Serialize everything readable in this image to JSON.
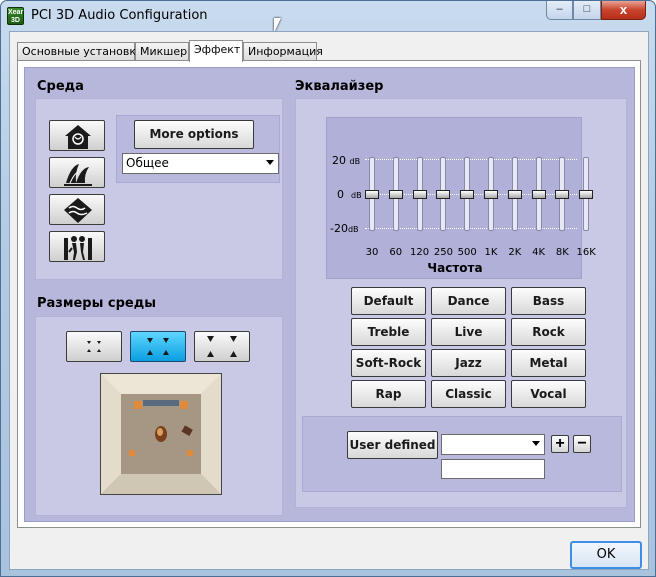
{
  "window": {
    "title": "PCI 3D Audio Configuration",
    "icon_text": "Xear 3D",
    "controls": {
      "minimize": "–",
      "maximize": "□",
      "close": "x"
    }
  },
  "tabs": [
    {
      "label": "Основные установки",
      "active": false
    },
    {
      "label": "Микшер",
      "active": false
    },
    {
      "label": "Эффект",
      "active": true
    },
    {
      "label": "Информация",
      "active": false
    }
  ],
  "environment": {
    "title": "Среда",
    "more_options": "More options",
    "selected": "Общее",
    "icons": [
      "room-icon",
      "opera-house-icon",
      "underwater-icon",
      "walking-icon"
    ]
  },
  "room_size": {
    "title": "Размеры среды",
    "selected_index": 1
  },
  "equalizer": {
    "title": "Эквалайзер",
    "db_top": "20",
    "db_mid": "0",
    "db_bottom": "-20",
    "db_unit": "dB",
    "bands": [
      "30",
      "60",
      "120",
      "250",
      "500",
      "1K",
      "2K",
      "4K",
      "8K",
      "16K"
    ],
    "levels_db": [
      0,
      0,
      0,
      0,
      0,
      0,
      0,
      0,
      0,
      0
    ],
    "axis_label": "Частота",
    "presets": [
      "Default",
      "Dance",
      "Bass",
      "Treble",
      "Live",
      "Rock",
      "Soft-Rock",
      "Jazz",
      "Metal",
      "Rap",
      "Classic",
      "Vocal"
    ],
    "user_defined": "User defined",
    "user_select_value": "",
    "user_name_value": "",
    "plus": "+",
    "minus": "−"
  },
  "footer": {
    "ok": "OK"
  }
}
